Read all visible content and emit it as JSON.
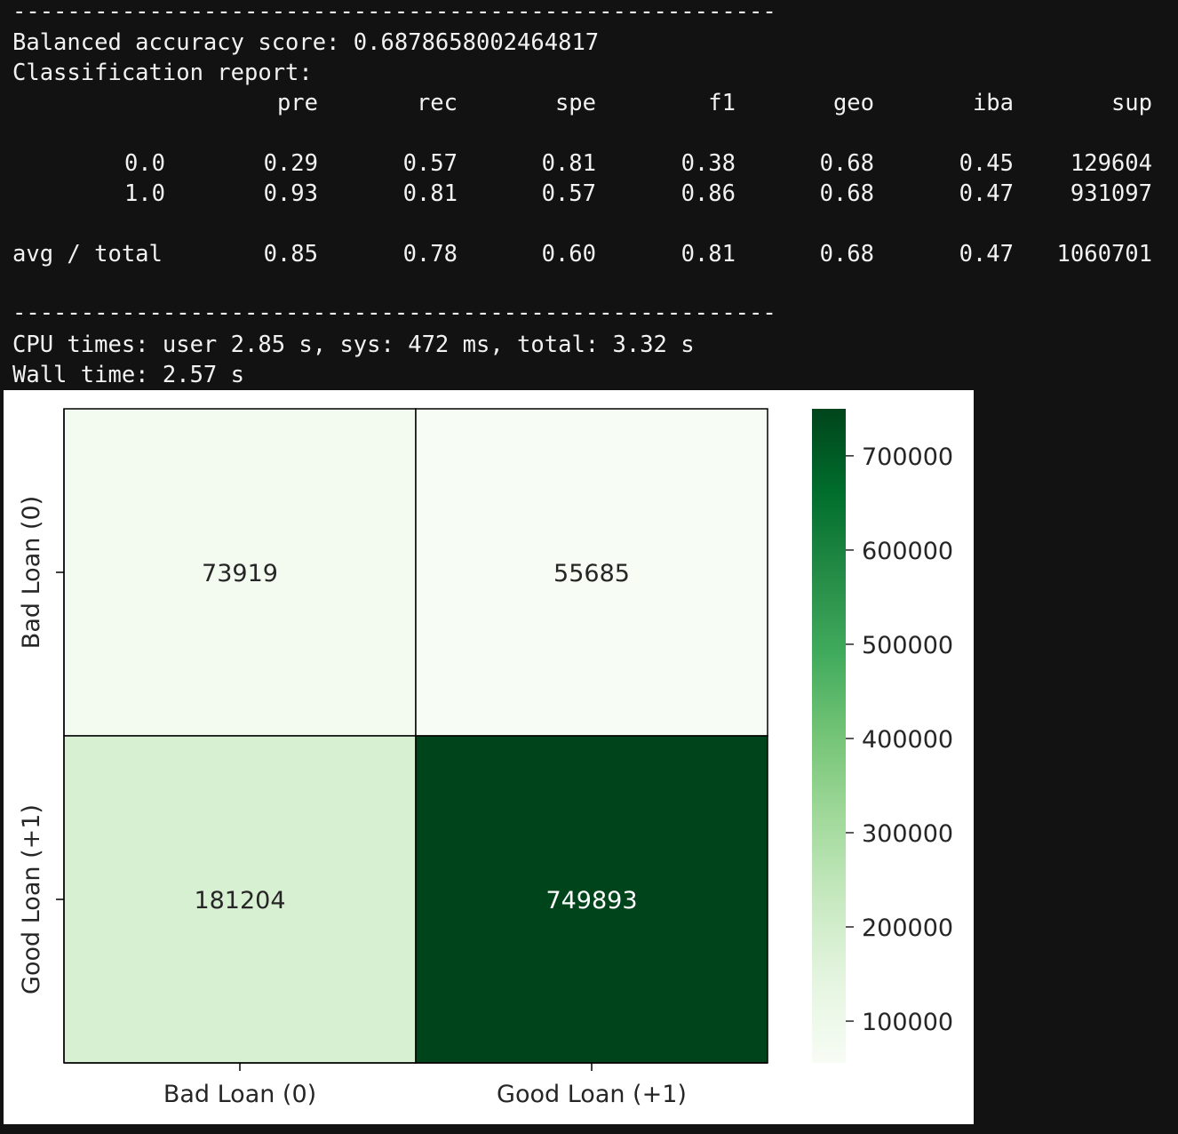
{
  "terminal": {
    "separator": "----------------------------------------------------------------------------------------------------------",
    "balanced_accuracy_line": "Balanced accuracy score: 0.6878658002464817",
    "classification_report_line": "Classification report:",
    "report_headers": [
      "pre",
      "rec",
      "spe",
      "f1",
      "geo",
      "iba",
      "sup"
    ],
    "report_rows": [
      {
        "label": "0.0",
        "values": [
          "0.29",
          "0.57",
          "0.81",
          "0.38",
          "0.68",
          "0.45",
          "129604"
        ]
      },
      {
        "label": "1.0",
        "values": [
          "0.93",
          "0.81",
          "0.57",
          "0.86",
          "0.68",
          "0.47",
          "931097"
        ]
      }
    ],
    "report_total": {
      "label": "avg / total",
      "values": [
        "0.85",
        "0.78",
        "0.60",
        "0.81",
        "0.68",
        "0.47",
        "1060701"
      ]
    },
    "cpu_times_line": "CPU times: user 2.85 s, sys: 472 ms, total: 3.32 s",
    "wall_time_line": "Wall time: 2.57 s"
  },
  "chart_data": {
    "type": "heatmap",
    "x_categories": [
      "Bad Loan (0)",
      "Good Loan (+1)"
    ],
    "y_categories": [
      "Bad Loan (0)",
      "Good Loan (+1)"
    ],
    "values": [
      [
        73919,
        55685
      ],
      [
        181204,
        749893
      ]
    ],
    "value_labels": [
      [
        "73919",
        "55685"
      ],
      [
        "181204",
        "749893"
      ]
    ],
    "colorbar": {
      "min": 55685,
      "max": 749893,
      "ticks": [
        100000,
        200000,
        300000,
        400000,
        500000,
        600000,
        700000
      ],
      "tick_labels": [
        "100000",
        "200000",
        "300000",
        "400000",
        "500000",
        "600000",
        "700000"
      ],
      "colormap": "Greens",
      "color_low": "#f7fcf5",
      "color_high": "#00441b"
    },
    "cell_border_color": "#000000",
    "title": "",
    "xlabel": "",
    "ylabel": ""
  }
}
